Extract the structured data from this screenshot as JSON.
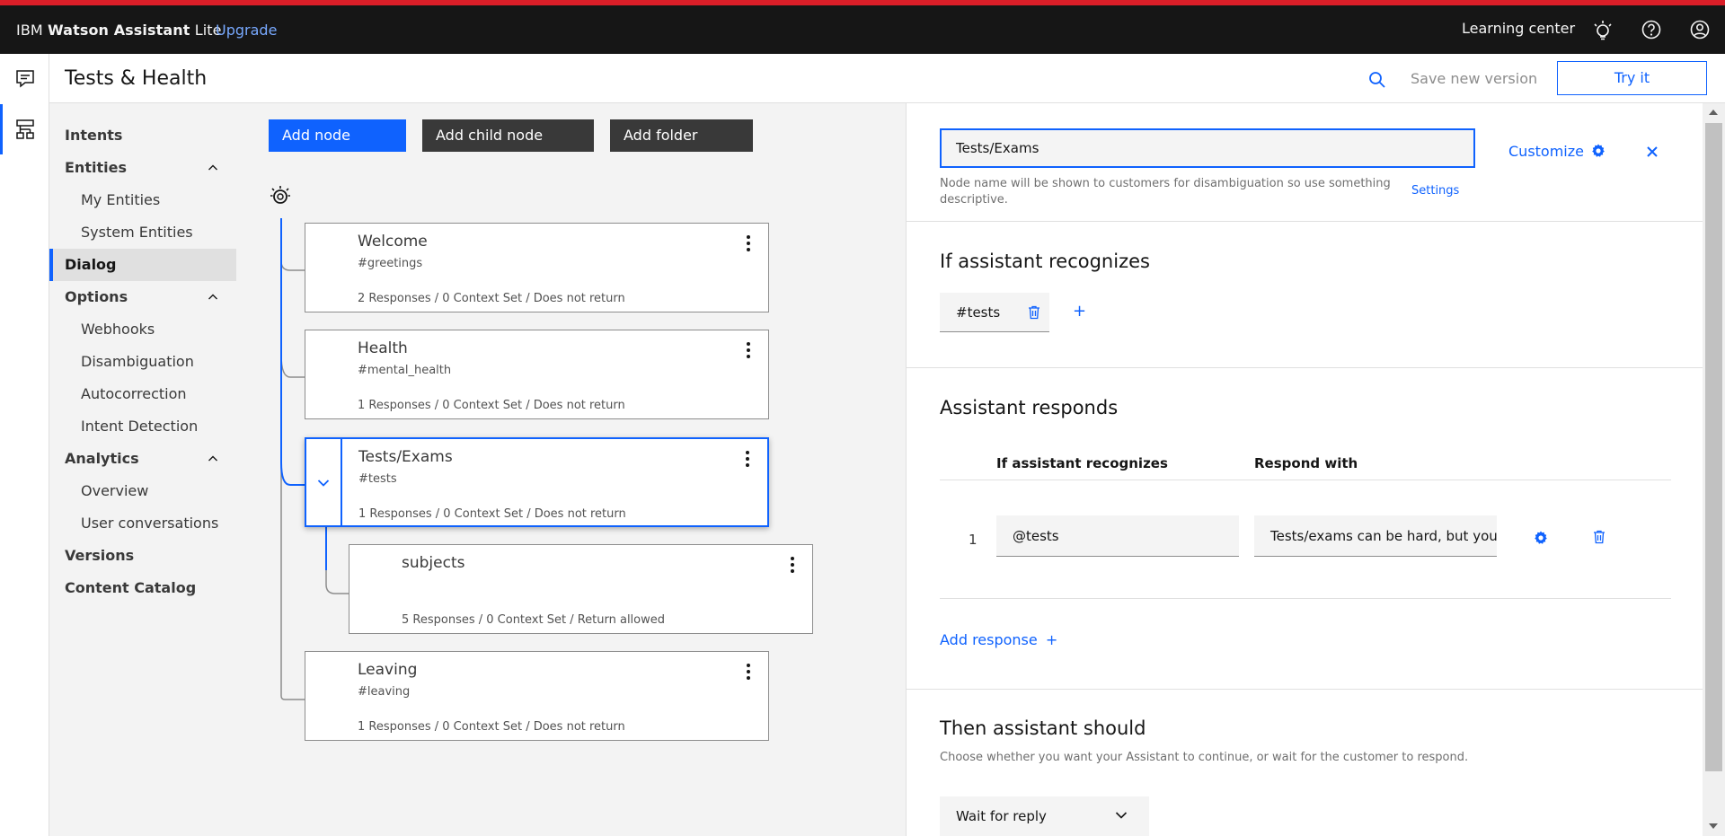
{
  "app": {
    "brand_prefix": "IBM ",
    "brand_bold": "Watson Assistant",
    "brand_suffix": " Lite",
    "upgrade": "Upgrade",
    "learning_center": "Learning center"
  },
  "header": {
    "title": "Tests & Health",
    "save_version": "Save new version",
    "try_it": "Try it"
  },
  "sidebar": {
    "items": [
      {
        "label": "Intents"
      },
      {
        "label": "Entities"
      },
      {
        "label": "My Entities"
      },
      {
        "label": "System Entities"
      },
      {
        "label": "Dialog"
      },
      {
        "label": "Options"
      },
      {
        "label": "Webhooks"
      },
      {
        "label": "Disambiguation"
      },
      {
        "label": "Autocorrection"
      },
      {
        "label": "Intent Detection"
      },
      {
        "label": "Analytics"
      },
      {
        "label": "Overview"
      },
      {
        "label": "User conversations"
      },
      {
        "label": "Versions"
      },
      {
        "label": "Content Catalog"
      }
    ]
  },
  "toolbar": {
    "add_node": "Add node",
    "add_child_node": "Add child node",
    "add_folder": "Add folder"
  },
  "nodes": [
    {
      "name": "Welcome",
      "intent": "#greetings",
      "footer": "2 Responses / 0 Context Set / Does not return"
    },
    {
      "name": "Health",
      "intent": "#mental_health",
      "footer": "1 Responses / 0 Context Set / Does not return"
    },
    {
      "name": "Tests/Exams",
      "intent": "#tests",
      "footer": "1 Responses / 0 Context Set / Does not return"
    },
    {
      "name": "subjects",
      "intent": "",
      "footer": "5 Responses / 0 Context Set / Return allowed"
    },
    {
      "name": "Leaving",
      "intent": "#leaving",
      "footer": "1 Responses / 0 Context Set / Does not return"
    }
  ],
  "panel": {
    "node_name": "Tests/Exams",
    "customize": "Customize",
    "hint": "Node name will be shown to customers for disambiguation so use something descriptive.",
    "settings": "Settings",
    "recognizes_heading": "If assistant recognizes",
    "condition_chip": "#tests",
    "responds_heading": "Assistant responds",
    "col_recognizes": "If assistant recognizes",
    "col_respond": "Respond with",
    "row_number": "1",
    "row_condition": "@tests",
    "row_response": "Tests/exams can be hard, but you",
    "add_response": "Add response",
    "then_heading": "Then assistant should",
    "then_sub": "Choose whether you want your Assistant to continue, or wait for the customer to respond.",
    "then_value": "Wait for reply"
  },
  "icons": {
    "lightbulb": "lightbulb-icon",
    "help": "help-icon",
    "user": "user-avatar-icon",
    "chat": "chat-icon",
    "dialog": "dialog-tree-icon",
    "search": "search-icon",
    "gear": "gear-icon",
    "close": "close-icon",
    "trash": "trash-icon",
    "kebab": "overflow-menu-icon"
  },
  "colors": {
    "accent": "#0f62fe",
    "topbar": "#161616",
    "top_stripe": "#da1e28"
  }
}
